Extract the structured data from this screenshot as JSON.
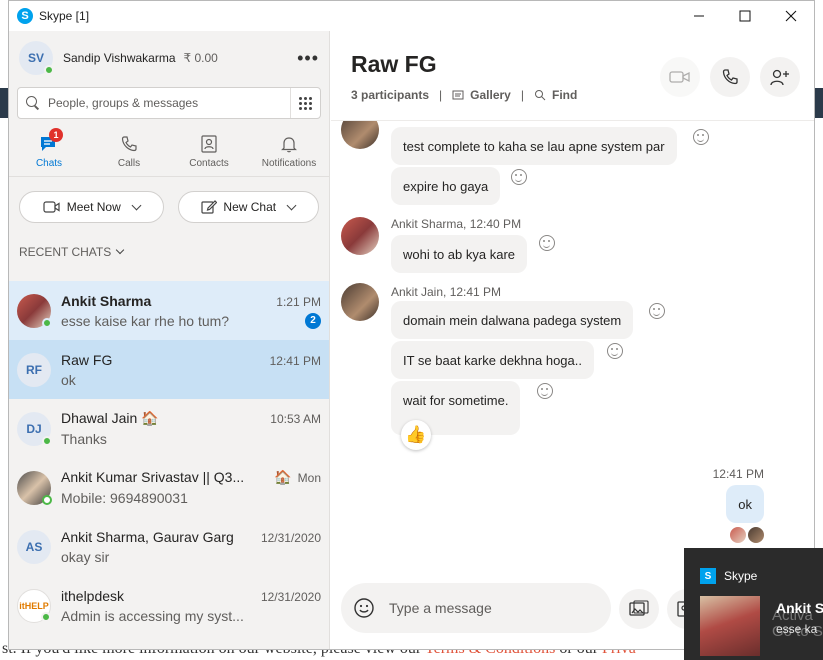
{
  "window": {
    "title": "Skype [1]",
    "app_icon": "S"
  },
  "profile": {
    "initials": "SV",
    "name": "Sandip Vishwakarma",
    "credit": "₹ 0.00"
  },
  "search": {
    "placeholder": "People, groups & messages"
  },
  "tabs": [
    {
      "label": "Chats",
      "badge": "1"
    },
    {
      "label": "Calls"
    },
    {
      "label": "Contacts"
    },
    {
      "label": "Notifications"
    }
  ],
  "actions": {
    "meet_now": "Meet Now",
    "new_chat": "New Chat"
  },
  "recent_header": "RECENT CHATS",
  "chats": [
    {
      "name": "Ankit Sharma",
      "time": "1:21 PM",
      "preview": "esse kaise kar rhe ho tum?",
      "unread": "2"
    },
    {
      "initials": "RF",
      "name": "Raw FG",
      "time": "12:41 PM",
      "preview": "ok"
    },
    {
      "initials": "DJ",
      "name": "Dhawal Jain",
      "emoji": "🏠",
      "time": "10:53 AM",
      "preview": "Thanks"
    },
    {
      "name": "Ankit Kumar Srivastav || Q3...",
      "emoji": "🏠",
      "time": "Mon",
      "preview": "Mobile: 9694890031"
    },
    {
      "initials": "AS",
      "name": "Ankit Sharma, Gaurav Garg",
      "time": "12/31/2020",
      "preview": "okay sir"
    },
    {
      "name": "ithelpdesk",
      "avatar_text": "itHELP",
      "time": "12/31/2020",
      "preview": "Admin is accessing my syst..."
    }
  ],
  "conversation": {
    "title": "Raw FG",
    "participants": "3 participants",
    "gallery": "Gallery",
    "find": "Find",
    "messages": [
      {
        "text": "test complete to kaha se lau apne system par"
      },
      {
        "text": "expire ho gaya"
      },
      {
        "sender": "Ankit Sharma, 12:40 PM",
        "text": "wohi to ab kya kare"
      },
      {
        "sender": "Ankit Jain, 12:41 PM",
        "text": "domain mein dalwana padega system"
      },
      {
        "text": "IT se baat karke dekhna hoga.."
      },
      {
        "text": "wait for sometime.",
        "reaction": "👍"
      }
    ],
    "my_message": {
      "time": "12:41 PM",
      "text": "ok"
    },
    "composer_placeholder": "Type a message"
  },
  "toast": {
    "app": "Skype",
    "name": "Ankit S",
    "message": "esse ka",
    "watermark_line1": "Activa",
    "watermark_line2": "Go to S"
  },
  "background": {
    "footer_text_1": "st. If you'd like more information on our website, please view our ",
    "footer_link_1": "Terms & Conditions",
    "footer_text_2": " or our ",
    "footer_link_2": "Priva"
  },
  "colors": {
    "accent": "#0078d4",
    "presence": "#4cb847",
    "badge": "#e0312b",
    "selected": "#c7e0f4"
  }
}
